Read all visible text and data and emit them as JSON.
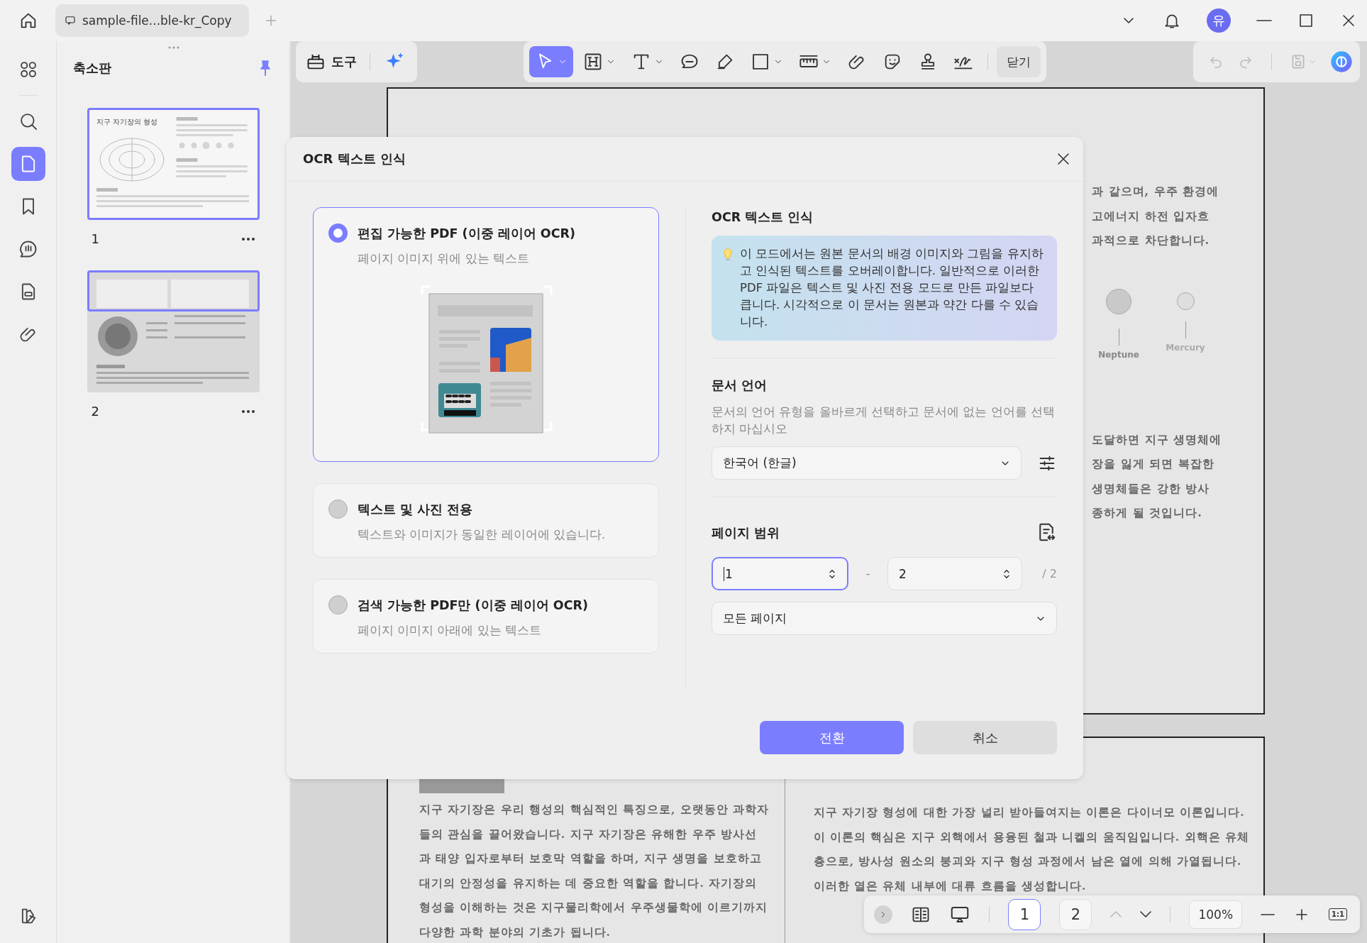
{
  "tab": {
    "title": "sample-file...ble-kr_Copy"
  },
  "user": {
    "initial": "유"
  },
  "rail": [
    {
      "kind": "grid",
      "selected": false
    },
    {
      "kind": "search",
      "selected": false
    },
    {
      "kind": "pages",
      "selected": true
    },
    {
      "kind": "bookmark",
      "selected": false
    },
    {
      "kind": "comment",
      "selected": false
    },
    {
      "kind": "form",
      "selected": false
    },
    {
      "kind": "attachment",
      "selected": false
    }
  ],
  "thumbnails": {
    "title": "축소판",
    "pages": [
      {
        "label": "1",
        "selected": true,
        "in_view": false,
        "heading": "지구 자기장의 형성"
      },
      {
        "label": "2",
        "selected": false,
        "in_view": true
      }
    ]
  },
  "toolbar": {
    "tools_label": "도구",
    "tools": [
      {
        "kind": "select",
        "selected": true,
        "dropdown": true
      },
      {
        "kind": "heading",
        "selected": false,
        "dropdown": true
      },
      {
        "kind": "text",
        "selected": false,
        "dropdown": true
      },
      {
        "kind": "comment",
        "selected": false,
        "dropdown": false
      },
      {
        "kind": "highlighter",
        "selected": false,
        "dropdown": false
      },
      {
        "kind": "shape",
        "selected": false,
        "dropdown": true
      },
      {
        "kind": "measure",
        "selected": false,
        "dropdown": true
      },
      {
        "kind": "attach",
        "selected": false,
        "dropdown": false
      },
      {
        "kind": "sticker",
        "selected": false,
        "dropdown": false
      },
      {
        "kind": "stamp",
        "selected": false,
        "dropdown": false
      },
      {
        "kind": "signature",
        "selected": false,
        "dropdown": false
      }
    ],
    "close": "닫기"
  },
  "document": {
    "page_1_top": [
      "과 같으며, 우주 환경에",
      "고에너지 하전 입자흐",
      "과적으로 차단합니다."
    ],
    "planets": [
      {
        "name": "Neptune",
        "kind": "large"
      },
      {
        "name": "Mercury",
        "kind": "small"
      }
    ],
    "page_1_bottom": [
      "도달하면 지구 생명체에",
      "장을 잃게 되면 복잡한",
      "생명체들은 강한 방사",
      "종하게 될 것입니다."
    ],
    "page_2_left": [
      "지구 자기장은 우리 행성의 핵심적인 특징으로, 오랫동안 과학자",
      "들의 관심을 끌어왔습니다. 지구 자기장은 유해한 우주 방사선",
      "과 태양 입자로부터 보호막 역할을 하며, 지구 생명을 보호하고",
      "대기의 안정성을 유지하는 데 중요한 역할을 합니다. 자기장의",
      "형성을 이해하는 것은 지구물리학에서 우주생물학에 이르기까지",
      "다양한 과학 분야의 기초가 됩니다."
    ],
    "page_2_right": [
      "지구 자기장 형성에 대한 가장 널리 받아들여지는 이론은 다이너모 이론입니다.",
      "이 이론의 핵심은 지구 외핵에서 용융된 철과 니켈의 움직임입니다. 외핵은 유체",
      "층으로, 방사성 원소의 붕괴와 지구 형성 과정에서 남은 열에 의해 가열됩니다.",
      "이러한 열은 유체 내부에 대류 흐름을 생성합니다."
    ]
  },
  "dialog": {
    "title": "OCR 텍스트 인식",
    "options": [
      {
        "title": "편집 가능한 PDF (이중 레이어 OCR)",
        "description": "페이지 이미지 위에 있는 텍스트",
        "selected": true
      },
      {
        "title": "텍스트 및 사진 전용",
        "description": "텍스트와 이미지가 동일한 레이어에 있습니다.",
        "selected": false
      },
      {
        "title": "검색 가능한 PDF만 (이중 레이어 OCR)",
        "description": "페이지 이미지 아래에 있는 텍스트",
        "selected": false
      }
    ],
    "heading": "OCR 텍스트 인식",
    "info": "이 모드에서는 원본 문서의 배경 이미지와 그림을 유지하고 인식된 텍스트를 오버레이합니다. 일반적으로 이러한 PDF 파일은 텍스트 및 사진 전용 모드로 만든 파일보다 큽니다. 시각적으로 이 문서는 원본과 약간 다를 수 있습니다.",
    "language": {
      "heading": "문서 언어",
      "description": "문서의 언어 유형을 올바르게 선택하고 문서에 없는 언어를 선택하지 마십시오",
      "value": "한국어 (한글)"
    },
    "range": {
      "heading": "페이지 범위",
      "start": "1",
      "separator": "-",
      "end": "2",
      "total": "/ 2",
      "value": "모든 페이지"
    },
    "convert": "전환",
    "cancel": "취소"
  },
  "page_nav": {
    "pages": [
      {
        "label": "1",
        "selected": true
      },
      {
        "label": "2",
        "selected": false
      }
    ],
    "zoom": "100%",
    "actual_size": "1:1"
  }
}
